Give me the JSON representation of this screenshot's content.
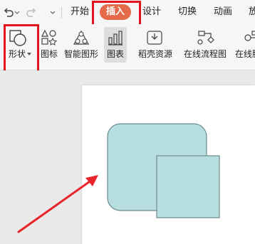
{
  "toolbar": {
    "tabs": [
      "开始",
      "插入",
      "设计",
      "切换",
      "动画",
      "放"
    ],
    "active_tab": "插入"
  },
  "ribbon": {
    "shape_label": "形状",
    "icons_label": "图标",
    "smartart_label": "智能图形",
    "chart_label": "图表",
    "resources_label": "稻壳资源",
    "flowchart_label": "在线流程图",
    "mindmap_label": "在线脑"
  },
  "colors": {
    "accent": "#e56a4a",
    "highlight": "#e3151c",
    "shape_fill": "#b8dfe0",
    "shape_stroke": "#6b8b8c"
  }
}
